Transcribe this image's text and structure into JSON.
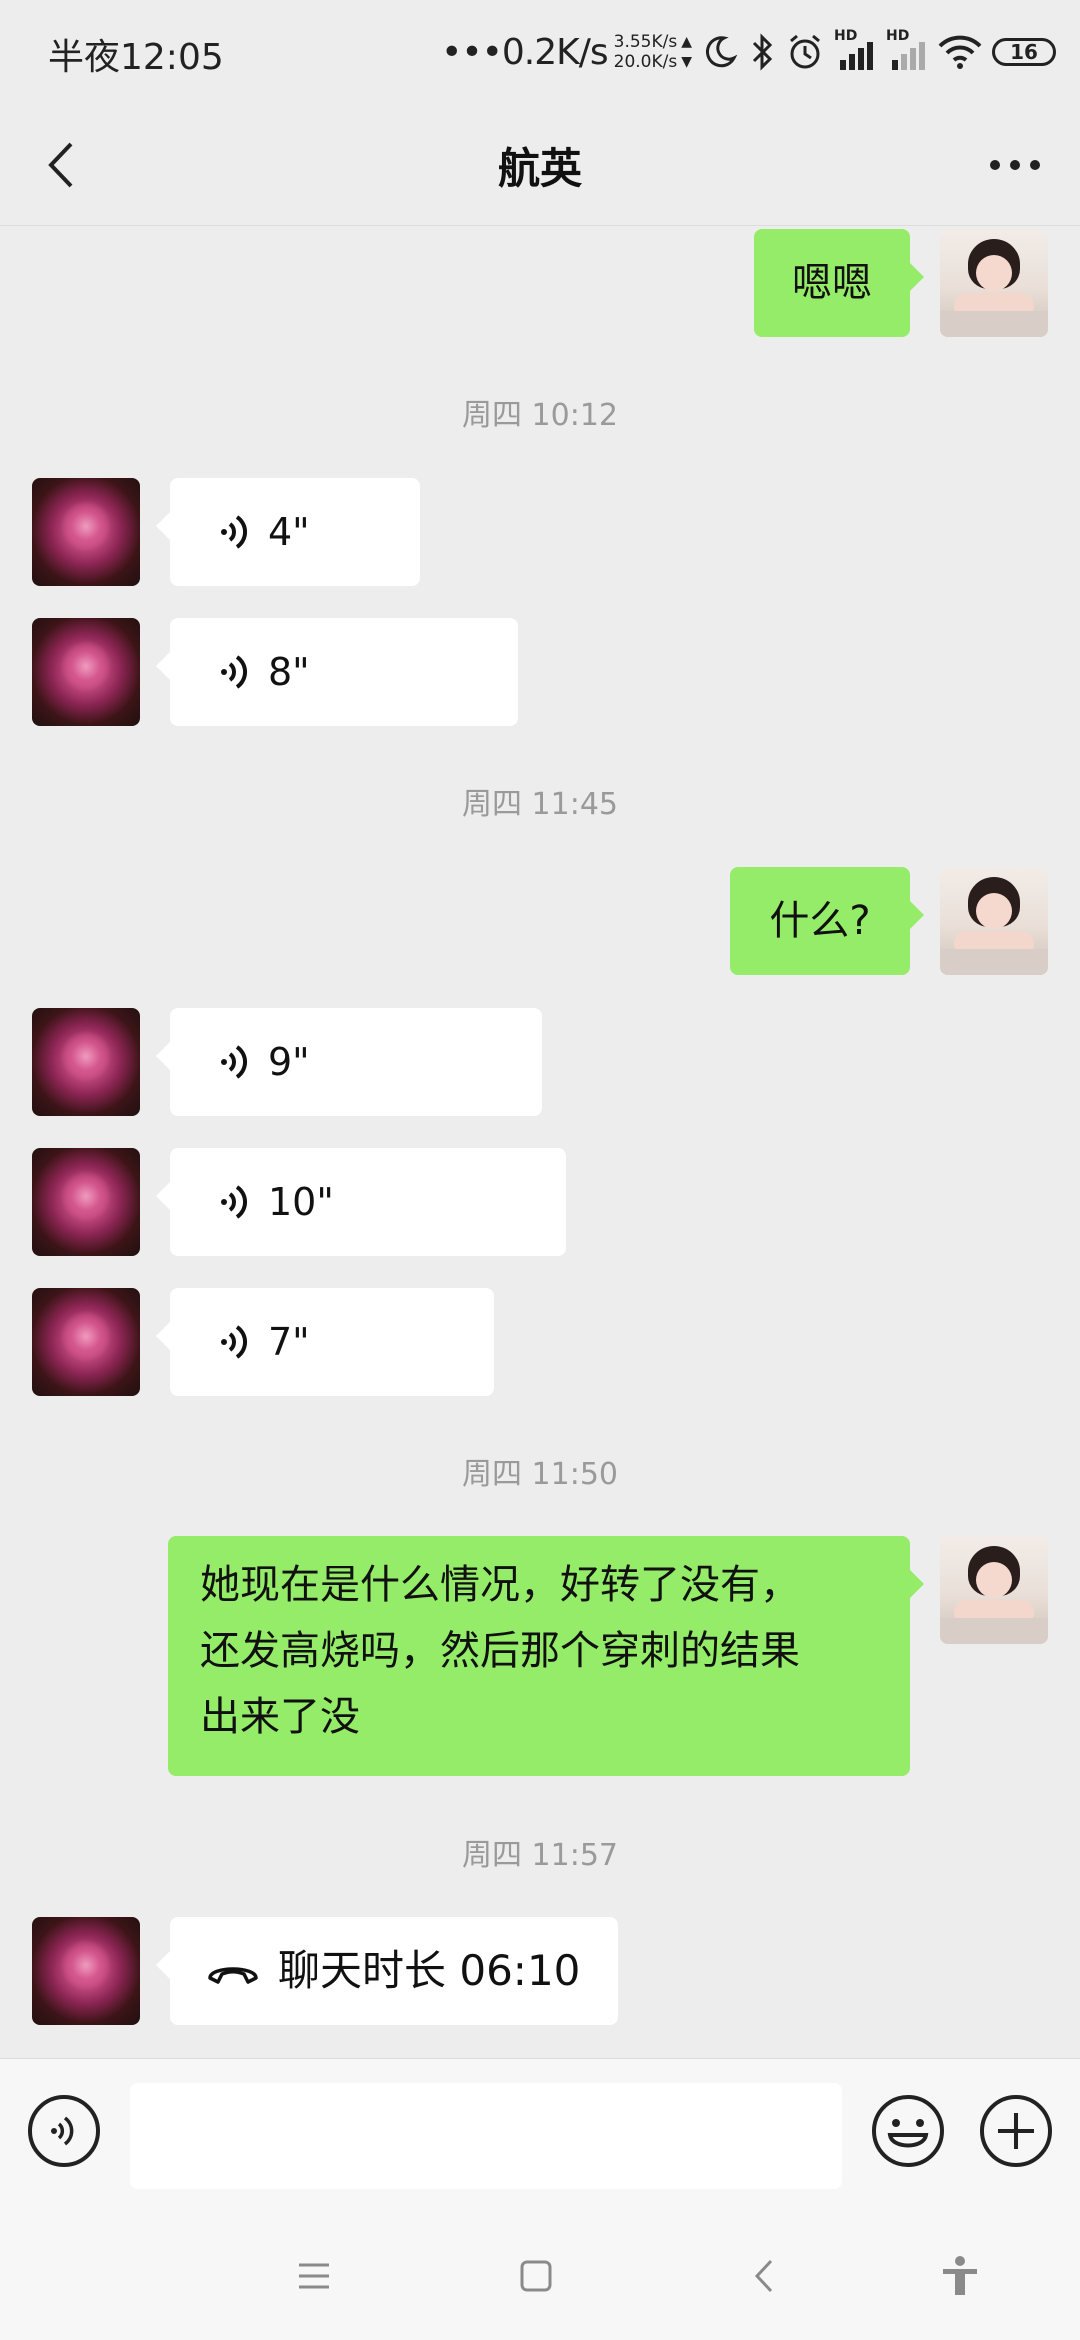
{
  "status_bar": {
    "time": "半夜12:05",
    "speed": "•••0.2K/s",
    "upload": "3.55K/s",
    "download": "20.0K/s",
    "up_arrow": "▲",
    "down_arrow": "▼",
    "hd1": "HD",
    "hd2": "HD",
    "battery": "16"
  },
  "header": {
    "title": "航英"
  },
  "messages": [
    {
      "kind": "text",
      "side": "out",
      "text": "嗯嗯"
    },
    {
      "kind": "timestamp",
      "text": "周四 10:12"
    },
    {
      "kind": "voice",
      "side": "in",
      "duration": "4\""
    },
    {
      "kind": "voice",
      "side": "in",
      "duration": "8\""
    },
    {
      "kind": "timestamp",
      "text": "周四 11:45"
    },
    {
      "kind": "text",
      "side": "out",
      "text": "什么?"
    },
    {
      "kind": "voice",
      "side": "in",
      "duration": "9\""
    },
    {
      "kind": "voice",
      "side": "in",
      "duration": "10\""
    },
    {
      "kind": "voice",
      "side": "in",
      "duration": "7\""
    },
    {
      "kind": "timestamp",
      "text": "周四 11:50"
    },
    {
      "kind": "text",
      "side": "out",
      "lines": [
        "她现在是什么情况，好转了没有，",
        "还发高烧吗，然后那个穿刺的结果",
        "出来了没"
      ]
    },
    {
      "kind": "timestamp",
      "text": "周四 11:57"
    },
    {
      "kind": "call",
      "side": "in",
      "text": "聊天时长 06:10"
    }
  ],
  "input_bar": {
    "placeholder": ""
  }
}
